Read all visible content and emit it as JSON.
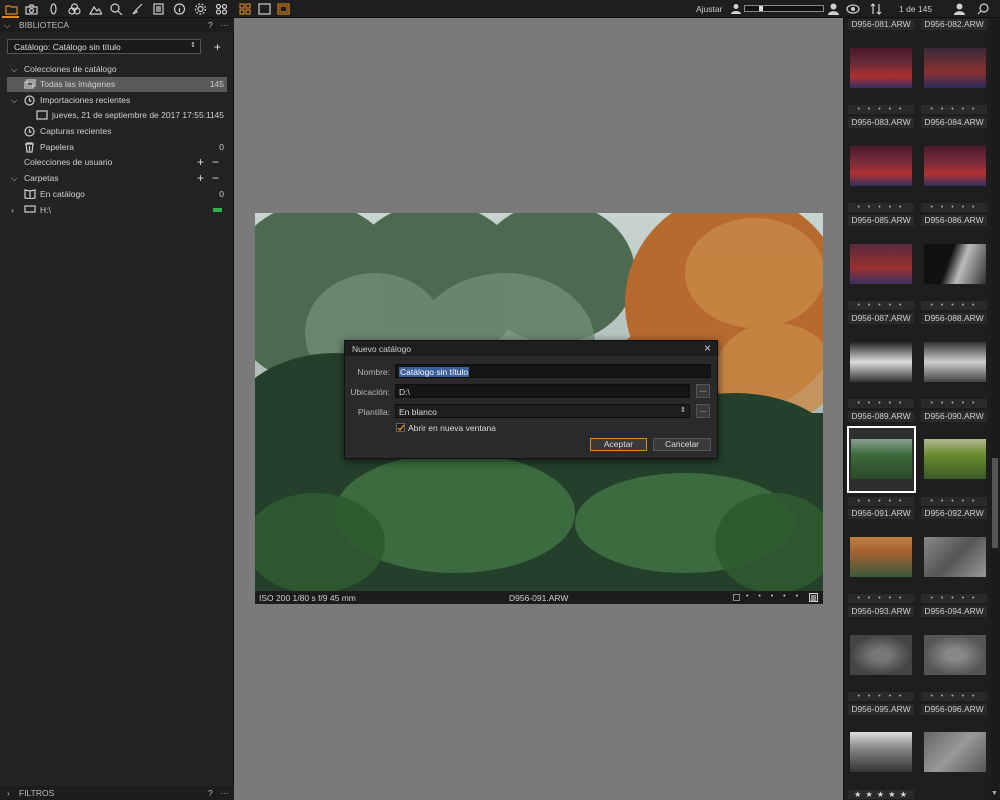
{
  "toolbar": {
    "adjust_label": "Ajustar",
    "counter": "1 de 145"
  },
  "library": {
    "header": "BIBLIOTECA",
    "help": "?",
    "more": "···",
    "catalog_select": "Catálogo:  Catálogo sin título",
    "catalog_collections": "Colecciones de catálogo",
    "all_images": "Todas las imágenes",
    "all_images_count": "145",
    "recent_imports": "Importaciones recientes",
    "import_date": "jueves, 21 de septiembre de 2017 17:55:1",
    "import_count": "145",
    "recent_captures": "Capturas recientes",
    "trash": "Papelera",
    "trash_count": "0",
    "user_collections": "Colecciones de usuario",
    "folders": "Carpetas",
    "in_catalog": "En catálogo",
    "in_catalog_count": "0",
    "drive": "H:\\"
  },
  "filters": {
    "header": "FILTROS",
    "help": "?",
    "more": "···"
  },
  "viewer": {
    "exif": "ISO 200  1/80 s  f/9  45 mm",
    "filename": "D956-091.ARW"
  },
  "dialog": {
    "title": "Nuevo catálogo",
    "name_label": "Nombre:",
    "name_value": "Catálogo sin título",
    "location_label": "Ubicación:",
    "location_value": "D:\\",
    "template_label": "Plantilla:",
    "template_value": "En blanco",
    "open_new_window": "Abrir en nueva ventana",
    "accept": "Aceptar",
    "cancel": "Cancelar",
    "browse": "..."
  },
  "browser": {
    "files": [
      "D956-081.ARW",
      "D956-082.ARW",
      "D956-083.ARW",
      "D956-084.ARW",
      "D956-085.ARW",
      "D956-086.ARW",
      "D956-087.ARW",
      "D956-088.ARW",
      "D956-089.ARW",
      "D956-090.ARW",
      "D956-091.ARW",
      "D956-092.ARW",
      "D956-093.ARW",
      "D956-094.ARW",
      "D956-095.ARW",
      "D956-096.ARW"
    ],
    "selected": "D956-091.ARW",
    "rating_dots": "• • • • •",
    "rating_stars": "★ ★ ★ ★ ★"
  },
  "colors": {
    "accent": "#e08a1e",
    "selection": "#5a5a5a",
    "panel": "#232323",
    "green_badge": "#2fb34a"
  }
}
